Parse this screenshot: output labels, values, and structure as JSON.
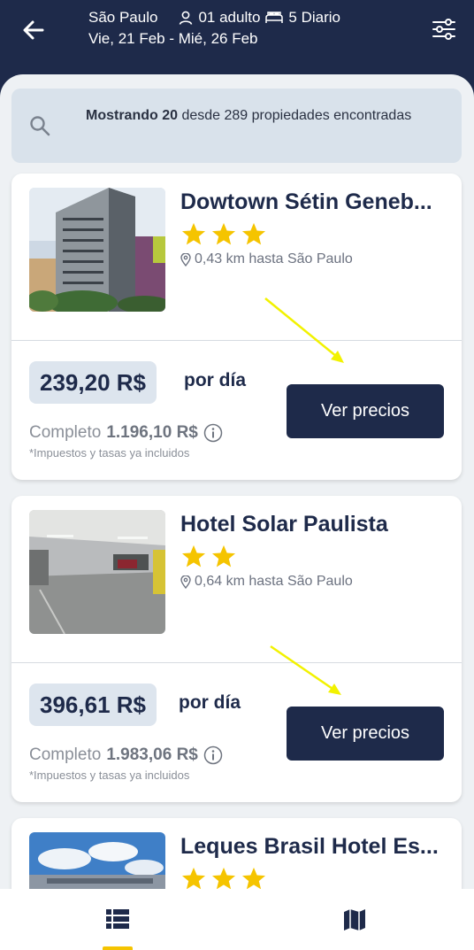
{
  "header": {
    "city": "São Paulo",
    "guests": "01 adulto",
    "rooms": "5 Diario",
    "dates": "Vie, 21 Feb - Mié, 26 Feb"
  },
  "summary": {
    "showing_bold": "Mostrando 20",
    "rest": " desde 289 propiedades encontradas"
  },
  "hotels": [
    {
      "name": "Dowtown Sétin Geneb...",
      "stars": 3,
      "distance": "0,43 km hasta São Paulo",
      "price": "239,20 R$",
      "per_day": "por día",
      "total_label": "Completo",
      "total_value": "1.196,10 R$",
      "taxes": "*Impuestos y tasas ya incluidos",
      "button": "Ver precios"
    },
    {
      "name": "Hotel Solar Paulista",
      "stars": 2,
      "distance": "0,64 km hasta São Paulo",
      "price": "396,61 R$",
      "per_day": "por día",
      "total_label": "Completo",
      "total_value": "1.983,06 R$",
      "taxes": "*Impuestos y tasas ya incluidos",
      "button": "Ver precios"
    },
    {
      "name": "Leques Brasil Hotel Es...",
      "stars": 3
    }
  ],
  "colors": {
    "navy": "#1e2a4a",
    "star": "#f5c400",
    "panel": "#eef1f4",
    "annotation_arrow": "#f2f200"
  },
  "icons": {
    "back": "arrow-left-icon",
    "guests": "person-icon",
    "rooms": "bed-icon",
    "filter": "sliders-icon",
    "search": "magnifier-icon",
    "location": "map-pin-icon",
    "info": "info-circle-icon",
    "nav_list": "list-icon",
    "nav_map": "map-icon"
  },
  "bottom_nav": {
    "active": "list"
  }
}
